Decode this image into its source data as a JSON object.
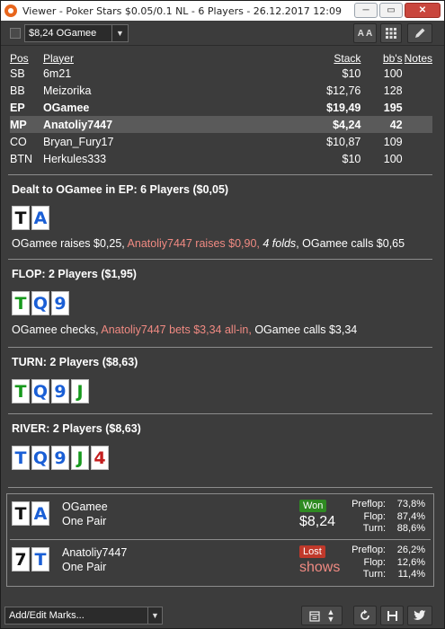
{
  "window": {
    "title": "Viewer - Poker Stars $0.05/0.1 NL - 6 Players - 26.12.2017 12:09",
    "minimize": "─",
    "maximize": "▭",
    "close": "✕"
  },
  "toolbar": {
    "player_select": "$8,24 OGamee",
    "font_button": "A A"
  },
  "players_table": {
    "headers": {
      "pos": "Pos",
      "player": "Player",
      "stack": "Stack",
      "bbs": "bb's",
      "notes": "Notes"
    },
    "rows": [
      {
        "pos": "SB",
        "player": "6m21",
        "stack": "$10",
        "bbs": "100",
        "bold": false
      },
      {
        "pos": "BB",
        "player": "Meizorika",
        "stack": "$12,76",
        "bbs": "128",
        "bold": false
      },
      {
        "pos": "EP",
        "player": "OGamee",
        "stack": "$19,49",
        "bbs": "195",
        "bold": true
      },
      {
        "pos": "MP",
        "player": "Anatoliy7447",
        "stack": "$4,24",
        "bbs": "42",
        "bold": true
      },
      {
        "pos": "CO",
        "player": "Bryan_Fury17",
        "stack": "$10,87",
        "bbs": "109",
        "bold": false
      },
      {
        "pos": "BTN",
        "player": "Herkules333",
        "stack": "$10",
        "bbs": "100",
        "bold": false
      }
    ]
  },
  "preflop": {
    "title": "Dealt to OGamee in EP: 6 Players ($0,05)",
    "cards": [
      {
        "rank": "T",
        "suit": "s"
      },
      {
        "rank": "A",
        "suit": "d"
      }
    ],
    "actions": {
      "hero_raise": "OGamee raises $0,25,",
      "villain_raise": " Anatoliy7447 raises $0,90,",
      "folds": " 4 folds",
      "hero_call": ", OGamee calls $0,65"
    }
  },
  "flop": {
    "title": "FLOP: 2 Players ($1,95)",
    "cards": [
      {
        "rank": "T",
        "suit": "c"
      },
      {
        "rank": "Q",
        "suit": "d"
      },
      {
        "rank": "9",
        "suit": "d"
      }
    ],
    "actions": {
      "hero_check": "OGamee checks,",
      "villain_bet": " Anatoliy7447 bets $3,34 all-in,",
      "hero_call": " OGamee calls $3,34"
    }
  },
  "turn": {
    "title": "TURN: 2 Players ($8,63)",
    "cards": [
      {
        "rank": "T",
        "suit": "c"
      },
      {
        "rank": "Q",
        "suit": "d"
      },
      {
        "rank": "9",
        "suit": "d"
      },
      {
        "rank": "J",
        "suit": "c"
      }
    ]
  },
  "river": {
    "title": "RIVER: 2 Players ($8,63)",
    "cards": [
      {
        "rank": "T",
        "suit": "d"
      },
      {
        "rank": "Q",
        "suit": "d"
      },
      {
        "rank": "9",
        "suit": "d"
      },
      {
        "rank": "J",
        "suit": "c"
      },
      {
        "rank": "4",
        "suit": "h"
      }
    ]
  },
  "summary": [
    {
      "cards": [
        {
          "rank": "T",
          "suit": "s"
        },
        {
          "rank": "A",
          "suit": "d"
        }
      ],
      "player": "OGamee",
      "hand": "One Pair",
      "result": "Won",
      "amount": "$8,24",
      "equity": {
        "preflop_label": "Preflop:",
        "preflop": "73,8%",
        "flop_label": "Flop:",
        "flop": "87,4%",
        "turn_label": "Turn:",
        "turn": "88,6%"
      }
    },
    {
      "cards": [
        {
          "rank": "7",
          "suit": "s"
        },
        {
          "rank": "T",
          "suit": "d"
        }
      ],
      "player": "Anatoliy7447",
      "hand": "One Pair",
      "result": "Lost",
      "amount": "shows",
      "equity": {
        "preflop_label": "Preflop:",
        "preflop": "26,2%",
        "flop_label": "Flop:",
        "flop": "12,6%",
        "turn_label": "Turn:",
        "turn": "11,4%"
      }
    }
  ],
  "bottombar": {
    "marks_select": "Add/Edit Marks..."
  },
  "colors": {
    "background": "#3c3c3c",
    "villain_action": "#f08a82",
    "won_badge": "#2f8a22",
    "lost_badge": "#c0392b",
    "spades": "#111111",
    "hearts": "#c41e1e",
    "diamonds": "#1a5fd6",
    "clubs": "#17991d"
  },
  "icons": [
    "pokerstars-icon",
    "minimize-icon",
    "maximize-icon",
    "close-icon",
    "font-size-icon",
    "grid-icon",
    "pencil-icon",
    "calendar-icon",
    "updown-icon",
    "refresh-icon",
    "save-icon",
    "twitter-icon"
  ]
}
